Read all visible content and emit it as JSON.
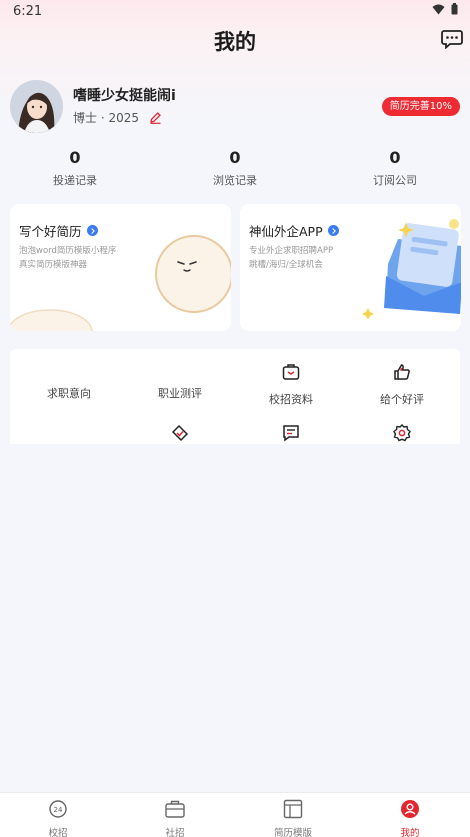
{
  "status": {
    "time": "6:21"
  },
  "header": {
    "title": "我的"
  },
  "profile": {
    "name": "嗜睡少女挺能闹i",
    "degree": "博士 · 2025",
    "resume_badge": "简历完善10%"
  },
  "stats": [
    {
      "value": "0",
      "label": "投递记录"
    },
    {
      "value": "0",
      "label": "浏览记录"
    },
    {
      "value": "0",
      "label": "订阅公司"
    }
  ],
  "promo_cards": [
    {
      "title": "写个好简历",
      "line1": "泡泡word简历模版小程序",
      "line2": "真实简历模版神器"
    },
    {
      "title": "神仙外企APP",
      "line1": "专业外企求职招聘APP",
      "line2": "跳槽/海归/全球机会"
    }
  ],
  "tools": [
    {
      "label": "求职意向",
      "icon": "target-icon"
    },
    {
      "label": "职业测评",
      "icon": "assessment-icon"
    },
    {
      "label": "校招资料",
      "icon": "briefcase-icon"
    },
    {
      "label": "给个好评",
      "icon": "thumbs-up-icon"
    },
    {
      "label": "",
      "icon": "ticket-check-icon"
    },
    {
      "label": "",
      "icon": "feedback-message-icon"
    },
    {
      "label": "",
      "icon": "settings-icon"
    }
  ],
  "bottom_nav": [
    {
      "label": "校招",
      "icon": "campus-24-icon"
    },
    {
      "label": "社招",
      "icon": "briefcase-icon"
    },
    {
      "label": "简历模版",
      "icon": "template-icon"
    },
    {
      "label": "我的",
      "icon": "profile-icon",
      "active": true
    }
  ],
  "colors": {
    "accent": "#e3262f",
    "badge": "#ee2a33",
    "link_blue": "#3a7cf0"
  }
}
